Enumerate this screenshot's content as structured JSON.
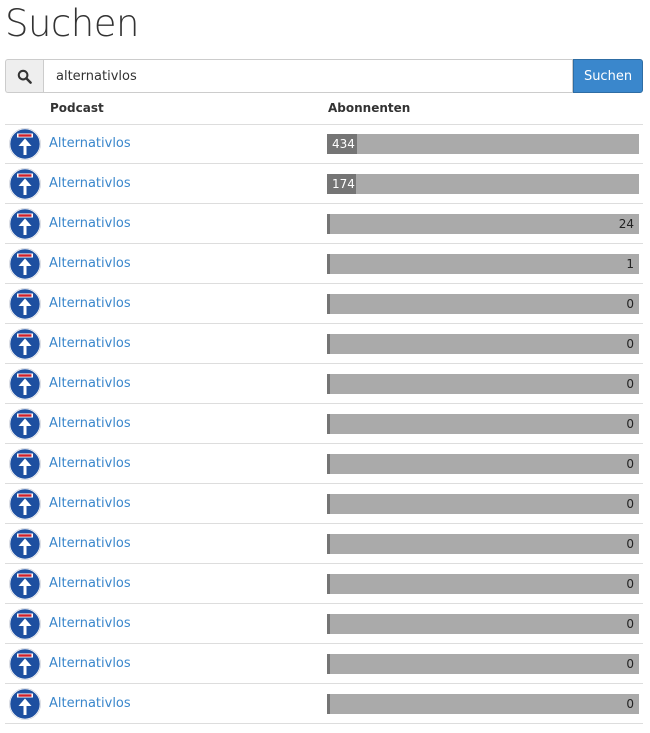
{
  "page": {
    "title": "Suchen"
  },
  "search": {
    "value": "alternativlos",
    "button_label": "Suchen"
  },
  "table": {
    "headers": {
      "podcast": "Podcast",
      "subscribers": "Abonnenten"
    },
    "max_subscribers": 434,
    "rows": [
      {
        "name": "Alternativlos",
        "subscribers": 434
      },
      {
        "name": "Alternativlos",
        "subscribers": 174
      },
      {
        "name": "Alternativlos",
        "subscribers": 24
      },
      {
        "name": "Alternativlos",
        "subscribers": 1
      },
      {
        "name": "Alternativlos",
        "subscribers": 0
      },
      {
        "name": "Alternativlos",
        "subscribers": 0
      },
      {
        "name": "Alternativlos",
        "subscribers": 0
      },
      {
        "name": "Alternativlos",
        "subscribers": 0
      },
      {
        "name": "Alternativlos",
        "subscribers": 0
      },
      {
        "name": "Alternativlos",
        "subscribers": 0
      },
      {
        "name": "Alternativlos",
        "subscribers": 0
      },
      {
        "name": "Alternativlos",
        "subscribers": 0
      },
      {
        "name": "Alternativlos",
        "subscribers": 0
      },
      {
        "name": "Alternativlos",
        "subscribers": 0
      },
      {
        "name": "Alternativlos",
        "subscribers": 0
      }
    ]
  },
  "icons": {
    "search": "search-icon",
    "podcast_logo": "podcast-logo-icon"
  },
  "colors": {
    "link": "#3a87cc",
    "button": "#3a87cc",
    "bar_track": "#aaaaaa",
    "bar_fill": "#757575",
    "logo_blue": "#1d4fa0",
    "logo_red": "#d0202a"
  }
}
